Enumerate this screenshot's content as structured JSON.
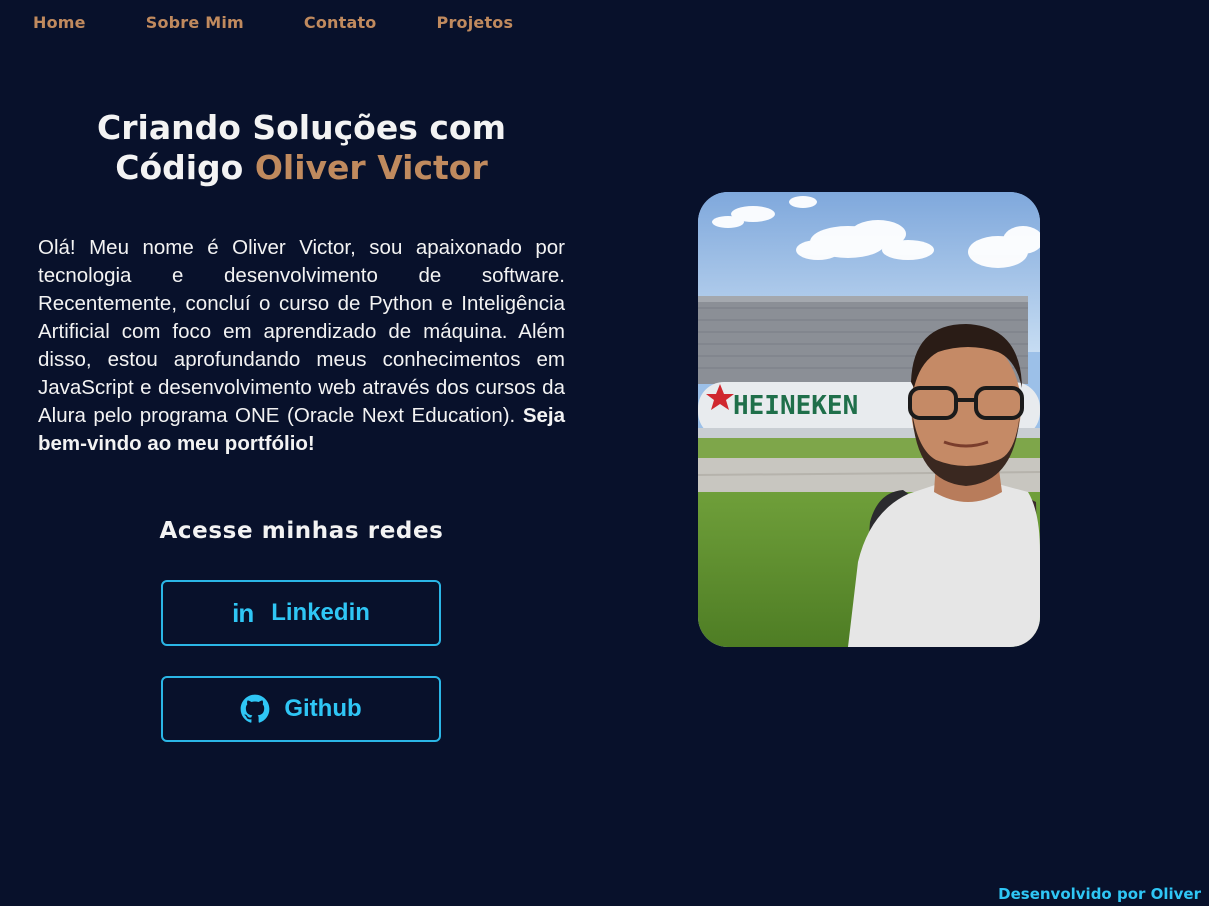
{
  "nav": {
    "items": [
      {
        "label": "Home"
      },
      {
        "label": "Sobre Mim"
      },
      {
        "label": "Contato"
      },
      {
        "label": "Projetos"
      }
    ]
  },
  "hero": {
    "title_line1": "Criando Soluções com",
    "title_line2_plain": "Código",
    "title_name": "Oliver Victor"
  },
  "intro": {
    "text": "Olá! Meu nome é Oliver Victor, sou apaixonado por tecnologia e desenvolvimento de software. Recentemente, concluí o curso de Python e Inteligência Artificial com foco em aprendizado de máquina. Além disso, estou aprofundando meus conhecimentos em JavaScript e desenvolvimento web através dos cursos da Alura pelo programa ONE (Oracle Next Education).",
    "emphasis": "Seja bem-vindo ao meu portfólio!"
  },
  "social": {
    "title": "Acesse minhas redes",
    "buttons": [
      {
        "label": "Linkedin",
        "icon": "linkedin-icon",
        "icon_text": "in"
      },
      {
        "label": "Github",
        "icon": "github-icon"
      }
    ]
  },
  "photo": {
    "sign_text": "HEINEKEN"
  },
  "footer": {
    "text": "Desenvolvido por Oliver"
  },
  "colors": {
    "background": "#08112b",
    "accent_brown": "#c08a5e",
    "accent_cyan": "#2fc6f5",
    "text": "#f3f3f3"
  }
}
